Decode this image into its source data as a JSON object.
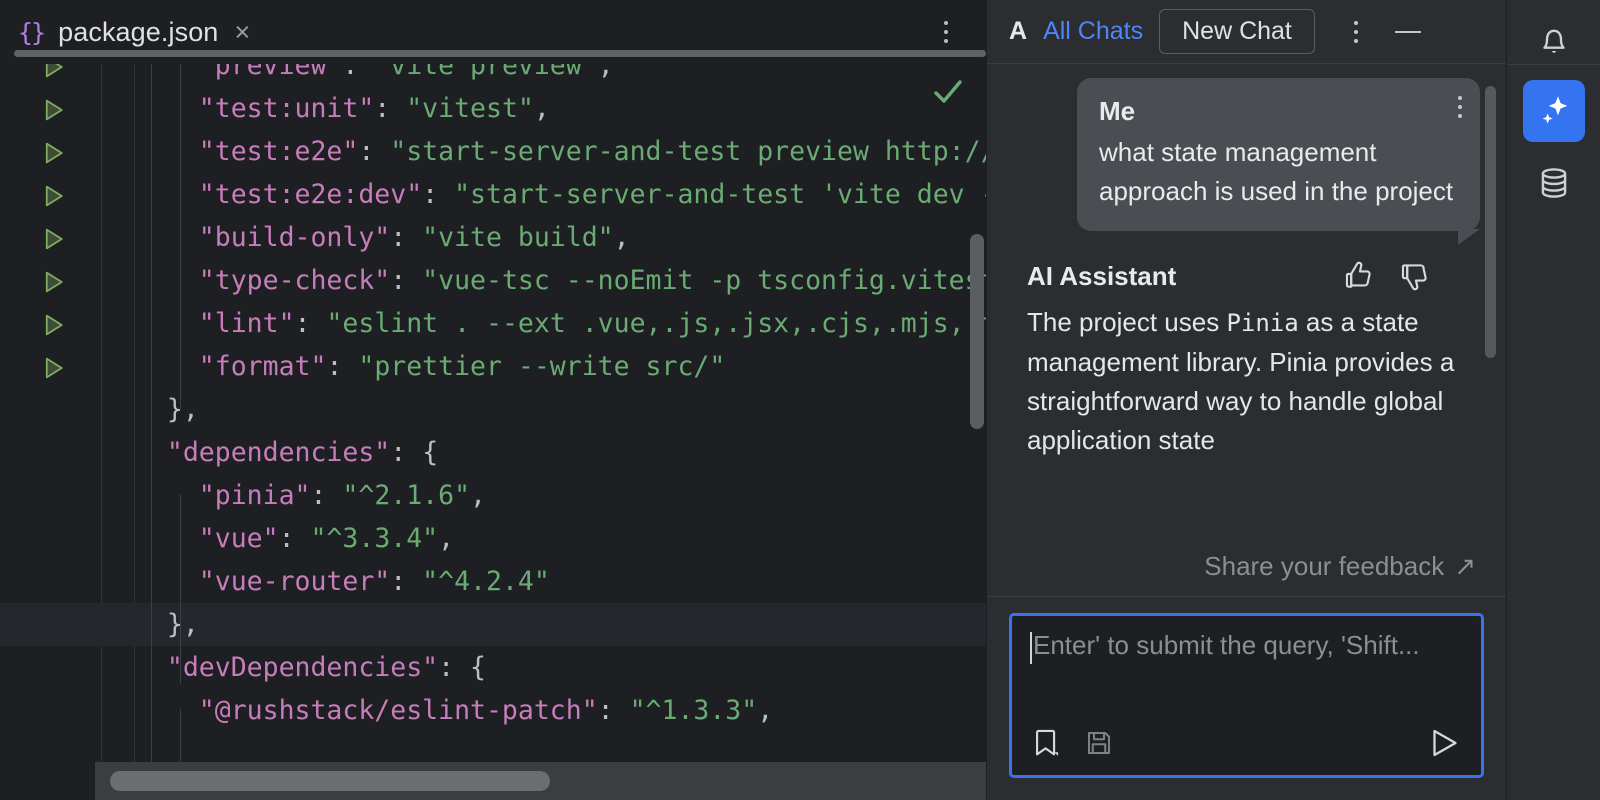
{
  "editor": {
    "tab": {
      "icon": "json-braces-icon",
      "title": "package.json",
      "close": "×"
    },
    "inspection_status": "ok-check-icon",
    "run_gutter_icon": "run-arrow-icon",
    "lines": [
      {
        "indent": 4,
        "key": "\"preview\"",
        "sep": ": ",
        "value": "\"vite preview\"",
        "tail": ",",
        "run": true
      },
      {
        "indent": 4,
        "key": "\"test:unit\"",
        "sep": ": ",
        "value": "\"vitest\"",
        "tail": ",",
        "run": true
      },
      {
        "indent": 4,
        "key": "\"test:e2e\"",
        "sep": ": ",
        "value": "\"start-server-and-test preview http://loca",
        "tail": "",
        "run": true
      },
      {
        "indent": 4,
        "key": "\"test:e2e:dev\"",
        "sep": ": ",
        "value": "\"start-server-and-test 'vite dev --por",
        "tail": "",
        "run": true
      },
      {
        "indent": 4,
        "key": "\"build-only\"",
        "sep": ": ",
        "value": "\"vite build\"",
        "tail": ",",
        "run": true
      },
      {
        "indent": 4,
        "key": "\"type-check\"",
        "sep": ": ",
        "value": "\"vue-tsc --noEmit -p tsconfig.vitest.js",
        "tail": "",
        "run": true
      },
      {
        "indent": 4,
        "key": "\"lint\"",
        "sep": ": ",
        "value": "\"eslint . --ext .vue,.js,.jsx,.cjs,.mjs,.ts,.t",
        "tail": "",
        "run": true
      },
      {
        "indent": 4,
        "key": "\"format\"",
        "sep": ": ",
        "value": "\"prettier --write src/\"",
        "tail": "",
        "run": true
      },
      {
        "indent": 2,
        "key": "",
        "sep": "",
        "value": "",
        "tail": "},",
        "run": false
      },
      {
        "indent": 2,
        "key": "\"dependencies\"",
        "sep": ": ",
        "value": "",
        "tail": "{",
        "run": false
      },
      {
        "indent": 4,
        "key": "\"pinia\"",
        "sep": ": ",
        "value": "\"^2.1.6\"",
        "tail": ",",
        "run": false
      },
      {
        "indent": 4,
        "key": "\"vue\"",
        "sep": ": ",
        "value": "\"^3.3.4\"",
        "tail": ",",
        "run": false
      },
      {
        "indent": 4,
        "key": "\"vue-router\"",
        "sep": ": ",
        "value": "\"^4.2.4\"",
        "tail": "",
        "run": false
      },
      {
        "indent": 2,
        "key": "",
        "sep": "",
        "value": "",
        "tail": "},",
        "run": false,
        "highlighted": true
      },
      {
        "indent": 2,
        "key": "\"devDependencies\"",
        "sep": ": ",
        "value": "",
        "tail": "{",
        "run": false
      },
      {
        "indent": 4,
        "key": "\"@rushstack/eslint-patch\"",
        "sep": ": ",
        "value": "\"^1.3.3\"",
        "tail": ",",
        "run": false
      }
    ],
    "scrollbars": {
      "vertical": "editor-vertical-scrollbar",
      "horizontal": "editor-horizontal-scrollbar"
    }
  },
  "ai_panel": {
    "header": {
      "logo": "A",
      "all_chats_label": "All Chats",
      "new_chat_label": "New Chat",
      "more_icon": "kebab-menu-icon",
      "minimize_icon": "minimize-icon"
    },
    "user_message": {
      "author": "Me",
      "text": "what state management approach is used in the project",
      "more_icon": "kebab-menu-icon"
    },
    "assistant_message": {
      "author": "AI Assistant",
      "text_before": "The project uses ",
      "code_token": "Pinia",
      "text_after": " as a state management library. Pinia provides a straightforward way to handle global application state",
      "thumbs_up_icon": "thumbs-up-icon",
      "thumbs_down_icon": "thumbs-down-icon"
    },
    "feedback": {
      "label": "Share your feedback",
      "arrow": "↗"
    },
    "input": {
      "placeholder": "Enter' to submit the query, 'Shift...",
      "value": "",
      "bookmark_icon": "bookmark-icon",
      "save_icon": "save-icon",
      "send_icon": "send-icon"
    }
  },
  "rail": {
    "items": [
      {
        "name": "notifications",
        "icon": "bell-icon",
        "active": false
      },
      {
        "name": "ai-assistant",
        "icon": "sparkle-icon",
        "active": true
      },
      {
        "name": "database",
        "icon": "database-icon",
        "active": false
      }
    ]
  },
  "colors": {
    "accent_blue": "#3574f0",
    "link_blue": "#4d87f7",
    "json_key": "#c77dbb",
    "json_string": "#6aab73",
    "editor_bg": "#1e1f22",
    "panel_bg": "#2b2d30"
  }
}
